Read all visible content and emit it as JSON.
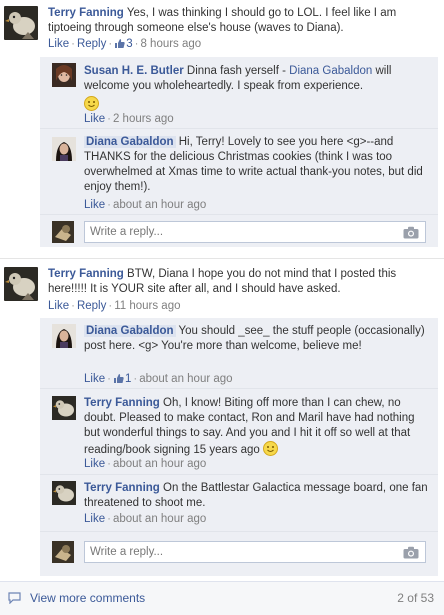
{
  "threads": [
    {
      "author": "Terry Fanning",
      "text": "Yes, I was thinking I should go to LOL. I feel like I am tiptoeing through someone else's house (waves to Diana).",
      "like_label": "Like",
      "reply_label": "Reply",
      "like_count": "3",
      "time": "8 hours ago",
      "replies": [
        {
          "author": "Susan H. E. Butler",
          "text_before": "Dinna fash yerself - ",
          "mention": "Diana Gabaldon",
          "text_after": " will welcome you wholeheartedly. I speak from experience.",
          "like_label": "Like",
          "time": "2 hours ago"
        },
        {
          "author": "Diana Gabaldon",
          "text": "Hi, Terry! Lovely to see you here <g>--and THANKS for the delicious Christmas cookies (think I was too overwhelmed at Xmas time to write actual thank-you notes, but did enjoy them!).",
          "like_label": "Like",
          "time": "about an hour ago"
        }
      ],
      "write_placeholder": "Write a reply..."
    },
    {
      "author": "Terry Fanning",
      "text": "BTW, Diana I hope you do not mind that I posted this here!!!!! It is YOUR site after all, and I should have asked.",
      "like_label": "Like",
      "reply_label": "Reply",
      "time": "11 hours ago",
      "replies": [
        {
          "author": "Diana Gabaldon",
          "text": "You should _see_ the stuff people (occasionally) post here. <g> You're more than welcome, believe me!",
          "like_label": "Like",
          "like_count": "1",
          "time": "about an hour ago"
        },
        {
          "author": "Terry Fanning",
          "text": "Oh, I know! Biting off more than I can chew, no doubt. Pleased to make contact, Ron and Maril have had nothing but wonderful things to say. And you and I hit it off so well at that reading/book signing 15 years ago",
          "like_label": "Like",
          "time": "about an hour ago"
        },
        {
          "author": "Terry Fanning",
          "text": "On the Battlestar Galactica message board, one fan threatened to shoot me.",
          "like_label": "Like",
          "time": "about an hour ago"
        }
      ],
      "write_placeholder": "Write a reply..."
    }
  ],
  "footer": {
    "view_more": "View more comments",
    "count": "2 of 53"
  },
  "colors": {
    "link": "#3b5998",
    "reply_bg": "#edeff4",
    "meta": "#7f7f7f"
  }
}
